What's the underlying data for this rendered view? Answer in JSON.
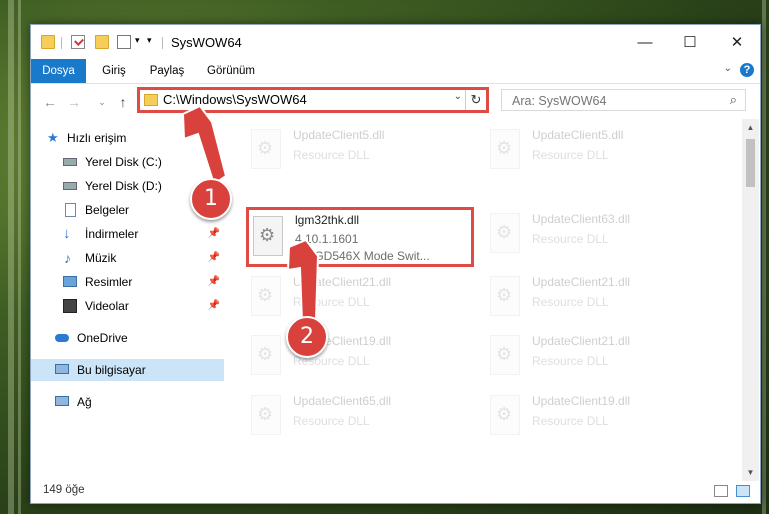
{
  "window": {
    "title": "SysWOW64",
    "controls": {
      "minimize": "—",
      "maximize": "☐",
      "close": "✕"
    }
  },
  "ribbon": {
    "tabs": [
      "Dosya",
      "Giriş",
      "Paylaş",
      "Görünüm"
    ],
    "help": "?"
  },
  "address": {
    "path": "C:\\Windows\\SysWOW64"
  },
  "search": {
    "placeholder": "Ara: SysWOW64"
  },
  "nav": {
    "quick_access": "Hızlı erişim",
    "items": [
      {
        "label": "Yerel Disk (C:)",
        "icon": "drive-icon",
        "pinned": true
      },
      {
        "label": "Yerel Disk (D:)",
        "icon": "drive-icon",
        "pinned": false
      },
      {
        "label": "Belgeler",
        "icon": "documents-icon",
        "pinned": true
      },
      {
        "label": "İndirmeler",
        "icon": "downloads-icon",
        "pinned": true
      },
      {
        "label": "Müzik",
        "icon": "music-icon",
        "pinned": true
      },
      {
        "label": "Resimler",
        "icon": "pictures-icon",
        "pinned": true
      },
      {
        "label": "Videolar",
        "icon": "videos-icon",
        "pinned": true
      }
    ],
    "onedrive": "OneDrive",
    "this_pc": "Bu bilgisayar",
    "network": "Ağ"
  },
  "files": {
    "highlighted": {
      "name": "lgm32thk.dll",
      "version": "4.10.1.1601",
      "description": "CL-GD546X Mode Swit..."
    },
    "left_col": [
      {
        "name": "UpdateClient5.dll",
        "desc": "Resource DLL"
      },
      {
        "name": "UpdateClient21.dll",
        "desc": "Resource DLL"
      },
      {
        "name": "UpdateClient19.dll",
        "desc": "Resource DLL"
      },
      {
        "name": "UpdateClient65.dll",
        "desc": "Resource DLL"
      }
    ],
    "right_col": [
      {
        "name": "UpdateClient5.dll",
        "desc": "Resource DLL"
      },
      {
        "name": "UpdateClient63.dll",
        "desc": "Resource DLL"
      },
      {
        "name": "UpdateClient21.dll",
        "desc": "Resource DLL"
      },
      {
        "name": "UpdateClient21.dll",
        "desc": "Resource DLL"
      },
      {
        "name": "UpdateClient19.dll",
        "desc": "Resource DLL"
      }
    ]
  },
  "status": {
    "count": "149 öğe"
  },
  "callouts": [
    "1",
    "2"
  ],
  "colors": {
    "accent": "#1979ca",
    "highlight": "#e04a44",
    "selected": "#cce4f7"
  }
}
